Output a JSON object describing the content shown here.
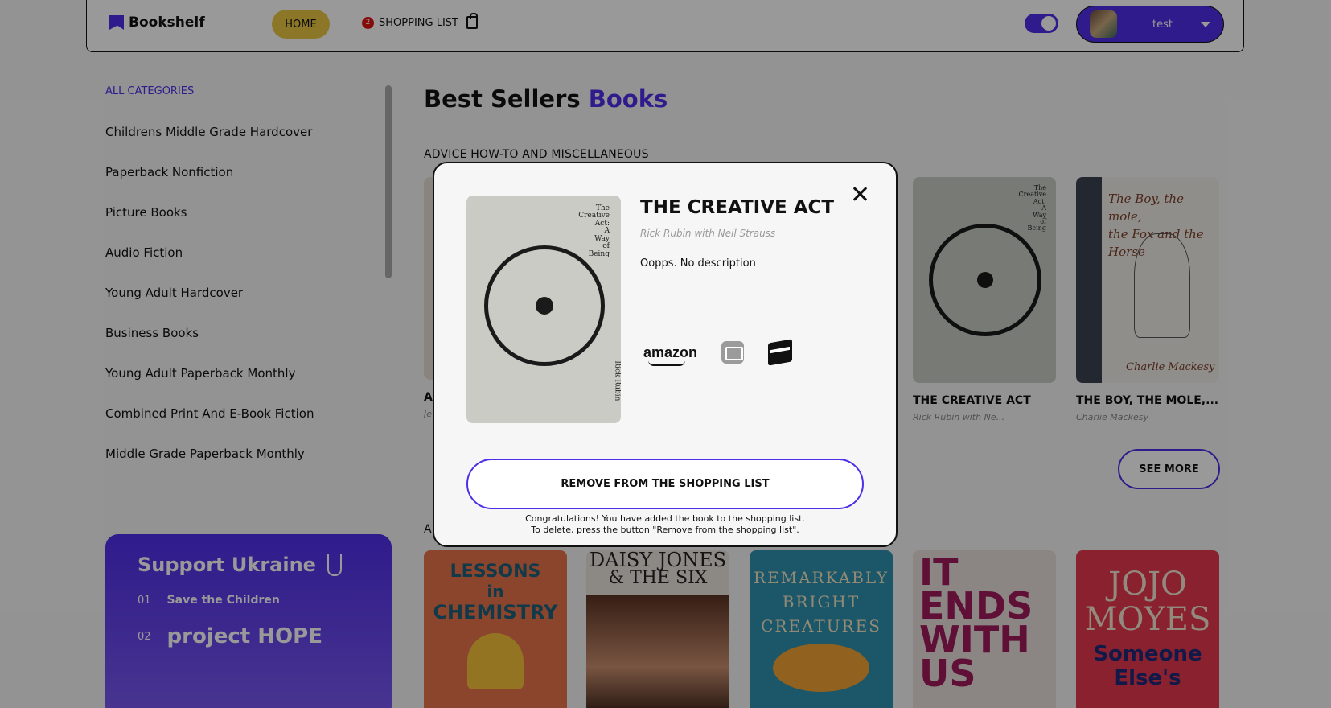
{
  "header": {
    "logo": "Bookshelf",
    "nav_home": "HOME",
    "nav_shopping": "SHOPPING LIST",
    "cart_count": "2",
    "user_name": "test"
  },
  "sidebar": {
    "categories": [
      "ALL CATEGORIES",
      "Childrens Middle Grade Hardcover",
      "Paperback Nonfiction",
      "Picture Books",
      "Audio Fiction",
      "Young Adult Hardcover",
      "Business Books",
      "Young Adult Paperback Monthly",
      "Combined Print And E-Book Fiction",
      "Middle Grade Paperback Monthly"
    ]
  },
  "support": {
    "title": "Support Ukraine",
    "funds": [
      {
        "num": "01",
        "name": "Save the Children"
      },
      {
        "num": "02",
        "name": "project HOPE"
      }
    ]
  },
  "main": {
    "title_part1": "Best Sellers",
    "title_part2": "Books",
    "section1": "ADVICE HOW-TO AND MISCELLANEOUS",
    "section2": "A",
    "see_more": "SEE MORE",
    "books_row1": [
      {
        "title": "THE CREATIVE ACT",
        "author": "Rick Rubin with Ne..."
      },
      {
        "title": "THE BOY, THE MOLE,...",
        "author": "Charlie Mackesy"
      }
    ],
    "partial_title": "A",
    "partial_author": "Je",
    "covers_row2": [
      {
        "line1": "LESSONS",
        "line2": "in",
        "line3": "CHEMISTRY"
      },
      {
        "line1": "DAISY JONES",
        "line2": "& THE SIX"
      },
      {
        "line1": "REMARKABLY",
        "line2": "BRIGHT",
        "line3": "CREATURES"
      },
      {
        "line1": "IT ENDS",
        "line2": "WITH",
        "line3": "US"
      },
      {
        "line1": "JOJO",
        "line2": "MOYES",
        "line3": "Someone Else's"
      }
    ]
  },
  "modal": {
    "title": "THE CREATIVE ACT",
    "author": "Rick Rubin with Neil Strauss",
    "description": "Oopps. No description",
    "cover_text": "The Creative Act: A Way of Being",
    "cover_author": "Rick Rubin",
    "amazon": "amazon",
    "remove_button": "REMOVE FROM THE SHOPPING LIST",
    "note_line1": "Congratulations! You have added the book to the shopping list.",
    "note_line2": "To delete, press the button \"Remove from the shopping list\"."
  },
  "colors": {
    "accent": "#4f2ee8",
    "home_pill": "#eac645",
    "badge": "#e01414"
  }
}
